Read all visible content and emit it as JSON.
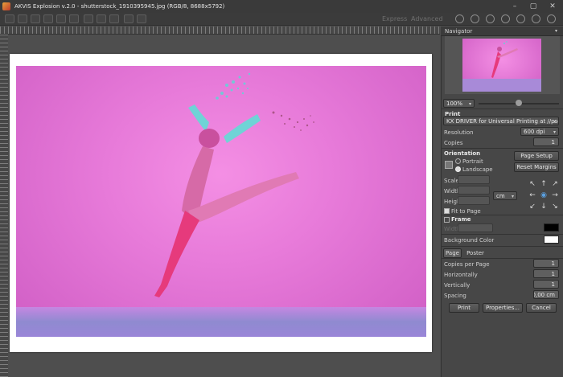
{
  "window": {
    "title": "AKVIS Explosion v.2.0 - shutterstock_1910395945.jpg (RGB/8, 8688x5792)",
    "min": "–",
    "max": "▢",
    "close": "✕"
  },
  "toolbar": {
    "mode_express": "Express",
    "mode_advanced": "Advanced"
  },
  "navigator": {
    "title": "Navigator",
    "zoom": "100%"
  },
  "print": {
    "section": "Print",
    "printer": "KX DRIVER for Universal Printing at //pser...",
    "resolution_label": "Resolution",
    "resolution": "600 dpi",
    "copies_label": "Copies",
    "copies": "1",
    "orientation_label": "Orientation",
    "portrait": "Portrait",
    "landscape": "Landscape",
    "page_setup": "Page Setup",
    "reset_margins": "Reset Margins",
    "scale_label": "Scale",
    "width_label": "Width",
    "height_label": "Height",
    "unit": "cm",
    "fit_to_page": "Fit to Page",
    "frame": "Frame",
    "width_small": "Width",
    "frame_color": "#000000",
    "background_color_label": "Background Color",
    "background_color": "#ffffff"
  },
  "tabs": {
    "page": "Page",
    "poster": "Poster"
  },
  "poster": {
    "copies_per_page_label": "Copies per Page",
    "copies_per_page": "1",
    "horizontally_label": "Horizontally",
    "horizontally": "1",
    "vertically_label": "Vertically",
    "vertically": "1",
    "spacing_label": "Spacing",
    "spacing": "0,00 cm"
  },
  "actions": {
    "print": "Print",
    "properties": "Properties...",
    "cancel": "Cancel"
  }
}
